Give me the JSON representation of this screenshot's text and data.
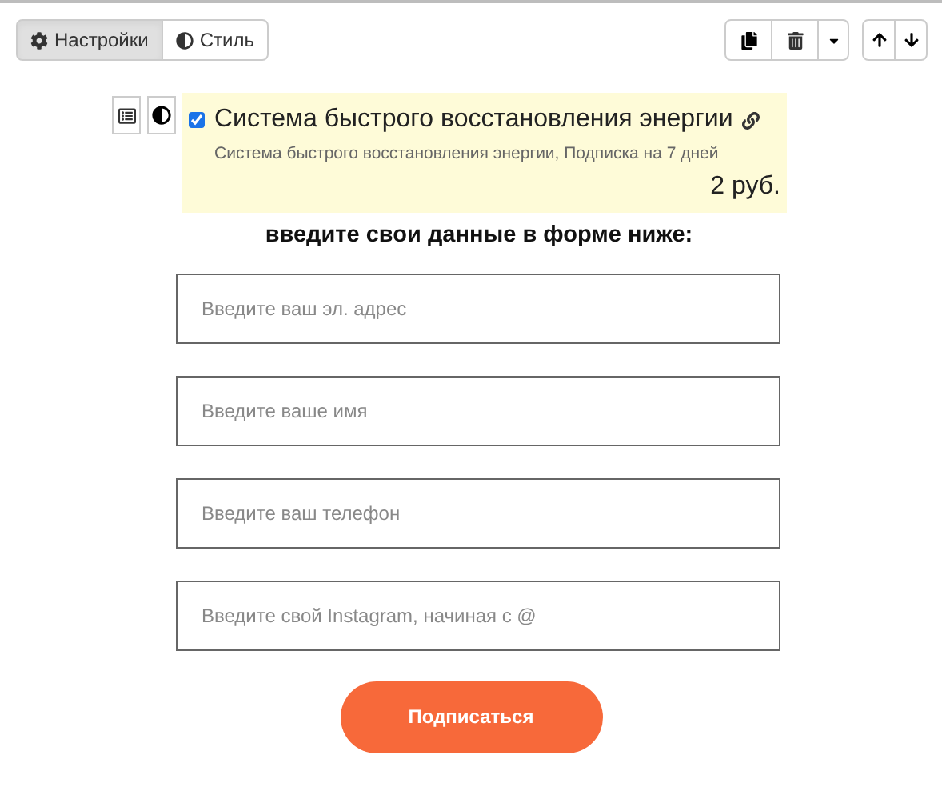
{
  "tabs": [
    {
      "label": "Настройки",
      "selected": true
    },
    {
      "label": "Стиль",
      "selected": false
    }
  ],
  "product": {
    "checked": true,
    "title": "Система быстрого восстановления энергии",
    "subtitle": "Система быстрого восстановления энергии, Подписка на 7 дней",
    "price": "2 руб."
  },
  "heading": "введите свои данные в форме ниже:",
  "fields": [
    {
      "placeholder": "Введите ваш эл. адрес"
    },
    {
      "placeholder": "Введите ваше имя"
    },
    {
      "placeholder": "Введите ваш телефон"
    },
    {
      "placeholder": "Введите свой Instagram, начиная с @"
    }
  ],
  "submit": "Подписаться"
}
